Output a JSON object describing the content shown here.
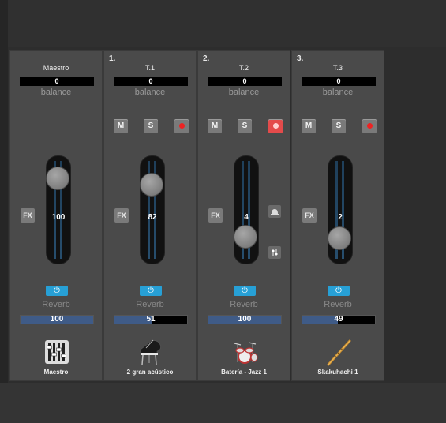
{
  "strips": [
    {
      "id": "maestro",
      "number": "",
      "name": "Maestro",
      "balance": "0",
      "balance_label": "balance",
      "has_msr": false,
      "fx_label": "FX",
      "fader_value": "100",
      "fader_level": 0.9,
      "reverb_label": "Reverb",
      "reverb_value": "100",
      "reverb_fill": 1.0,
      "instrument_label": "Maestro",
      "instrument_icon": "mixer-icon"
    },
    {
      "id": "t1",
      "number": "1.",
      "name": "T.1",
      "balance": "0",
      "balance_label": "balance",
      "has_msr": true,
      "mute_label": "M",
      "solo_label": "S",
      "record_active": false,
      "fx_label": "FX",
      "fader_value": "82",
      "fader_level": 0.82,
      "reverb_label": "Reverb",
      "reverb_value": "51",
      "reverb_fill": 0.51,
      "instrument_label": "2 gran acústico",
      "instrument_icon": "grand-piano-icon"
    },
    {
      "id": "t2",
      "number": "2.",
      "name": "T.2",
      "balance": "0",
      "balance_label": "balance",
      "has_msr": true,
      "mute_label": "M",
      "solo_label": "S",
      "record_active": true,
      "fx_label": "FX",
      "fader_value": "4",
      "fader_level": 0.2,
      "reverb_label": "Reverb",
      "reverb_value": "100",
      "reverb_fill": 1.0,
      "instrument_label": "Batería - Jazz 1",
      "instrument_icon": "drum-kit-icon"
    },
    {
      "id": "t3",
      "number": "3.",
      "name": "T.3",
      "balance": "0",
      "balance_label": "balance",
      "has_msr": true,
      "mute_label": "M",
      "solo_label": "S",
      "record_active": false,
      "fx_label": "FX",
      "fader_value": "2",
      "fader_level": 0.18,
      "reverb_label": "Reverb",
      "reverb_value": "49",
      "reverb_fill": 0.49,
      "instrument_label": "Skakuhachi 1",
      "instrument_icon": "flute-icon"
    }
  ],
  "colors": {
    "power_accent": "#27a0d6",
    "record_active": "#e44b4b",
    "record_dot": "#e22222",
    "send_fill": "#3f5b87"
  }
}
